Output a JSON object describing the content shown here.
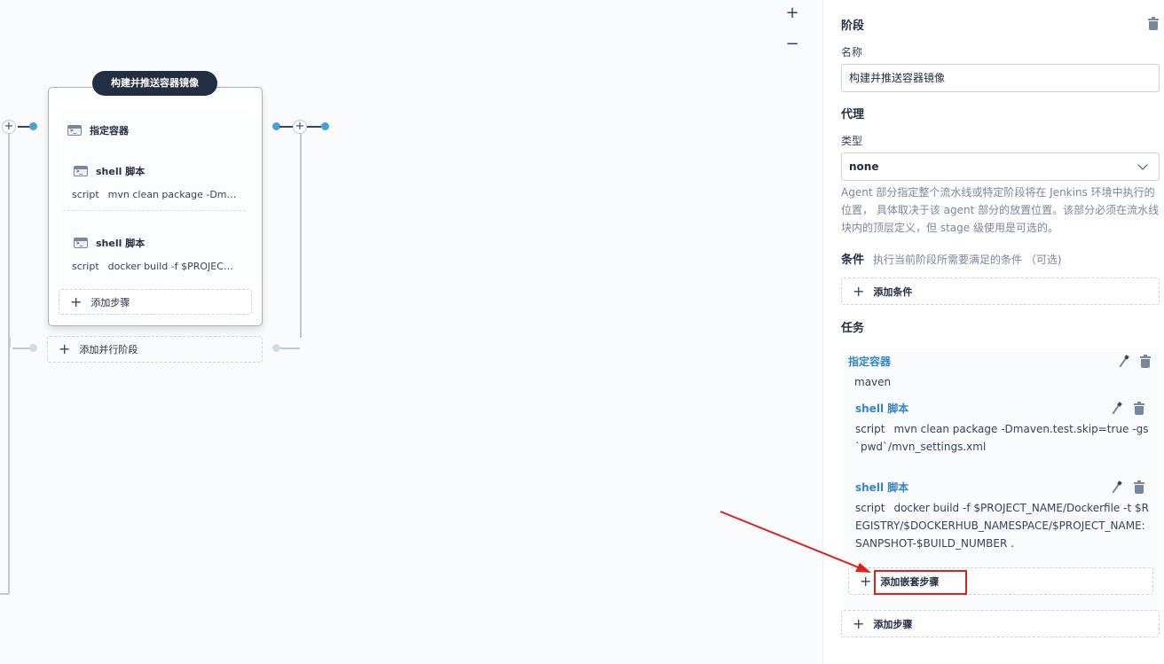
{
  "canvas": {
    "zoom_in": "+",
    "zoom_out": "−",
    "stage": {
      "title": "构建并推送容器镜像",
      "container_step": "指定容器",
      "steps": [
        {
          "name": "shell 脚本",
          "key": "script",
          "value": "mvn clean package -Dmaven.test.skip=true -gs `pwd`/mvn_settings.xml"
        },
        {
          "name": "shell 脚本",
          "key": "script",
          "value": "docker build -f $PROJECT_NAME/Dockerfile -t $REGISTRY/$DOCKERHUB_NAMESPACE/$PROJECT_NAME:SANPSHOT-$BUILD_NUMBER ."
        }
      ],
      "add_step": "添加步骤",
      "add_parallel_stage": "添加并行阶段"
    },
    "add_plus": "+"
  },
  "panel": {
    "section_title": "阶段",
    "name_label": "名称",
    "name_value": "构建并推送容器镜像",
    "agent_title": "代理",
    "type_label": "类型",
    "type_value": "none",
    "agent_desc": "Agent 部分指定整个流水线或特定阶段将在 Jenkins 环境中执行的位置， 具体取决于该 agent 部分的放置位置。该部分必须在流水线块内的顶层定义，但 stage 级使用是可选的。",
    "condition_title": "条件",
    "condition_hint": "执行当前阶段所需要满足的条件 （可选)",
    "add_condition": "添加条件",
    "tasks_title": "任务",
    "container_name": "指定容器",
    "container_value": "maven",
    "steps": [
      {
        "name": "shell 脚本",
        "key": "script",
        "value": "mvn clean package -Dmaven.test.skip=true -gs `pwd`/mvn_settings.xml"
      },
      {
        "name": "shell 脚本",
        "key": "script",
        "value": "docker build -f $PROJECT_NAME/Dockerfile -t $REGISTRY/$DOCKERHUB_NAMESPACE/$PROJECT_NAME:SANPSHOT-$BUILD_NUMBER ."
      }
    ],
    "add_nested_step": "添加嵌套步骤",
    "add_step": "添加步骤"
  },
  "colors": {
    "accent": "#3385c6",
    "node_dot": "#4d9fcf",
    "highlight": "#e01f1f",
    "stage_title_bg": "#242e42"
  }
}
